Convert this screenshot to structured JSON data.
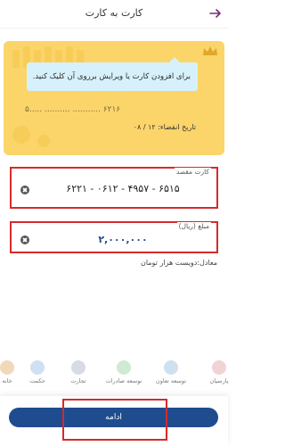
{
  "header": {
    "title": "کارت به کارت",
    "back_icon": "arrow-right-icon"
  },
  "colors": {
    "card_bg": "#fbd56a",
    "tooltip_bg": "#d6f1fb",
    "primary": "#1f4c8f",
    "highlight": "#d62a2a"
  },
  "card": {
    "tooltip": "برای افزودن کارت یا ویرایش برروی آن کلیک کنید.",
    "number_masked": "۵.....  ..........  ...........  ۶۲۱۶",
    "expiry_label": "تاریخ انقضاء: ۱۲ / ۰۸"
  },
  "destination": {
    "label": "کارت مقصد",
    "value": "۶۲۲۱ - ۰۶۱۲ - ۴۹۵۷ - ۶۵۱۵"
  },
  "amount": {
    "label": "مبلغ (ریال)",
    "value": "۲,۰۰۰,۰۰۰",
    "equivalent": "معادل:دویست هزار  تومان"
  },
  "services": [
    {
      "label": "خانه",
      "icon": "home-icon"
    },
    {
      "label": "حکمت",
      "icon": "wisdom-icon"
    },
    {
      "label": "تجارت",
      "icon": "trade-icon"
    },
    {
      "label": "توسعه صادرات",
      "icon": "export-icon"
    },
    {
      "label": "توسعه تعاون",
      "icon": "cooperation-icon"
    },
    {
      "label": "پارسیان",
      "icon": "parsian-icon"
    }
  ],
  "footer": {
    "continue_label": "ادامه"
  }
}
